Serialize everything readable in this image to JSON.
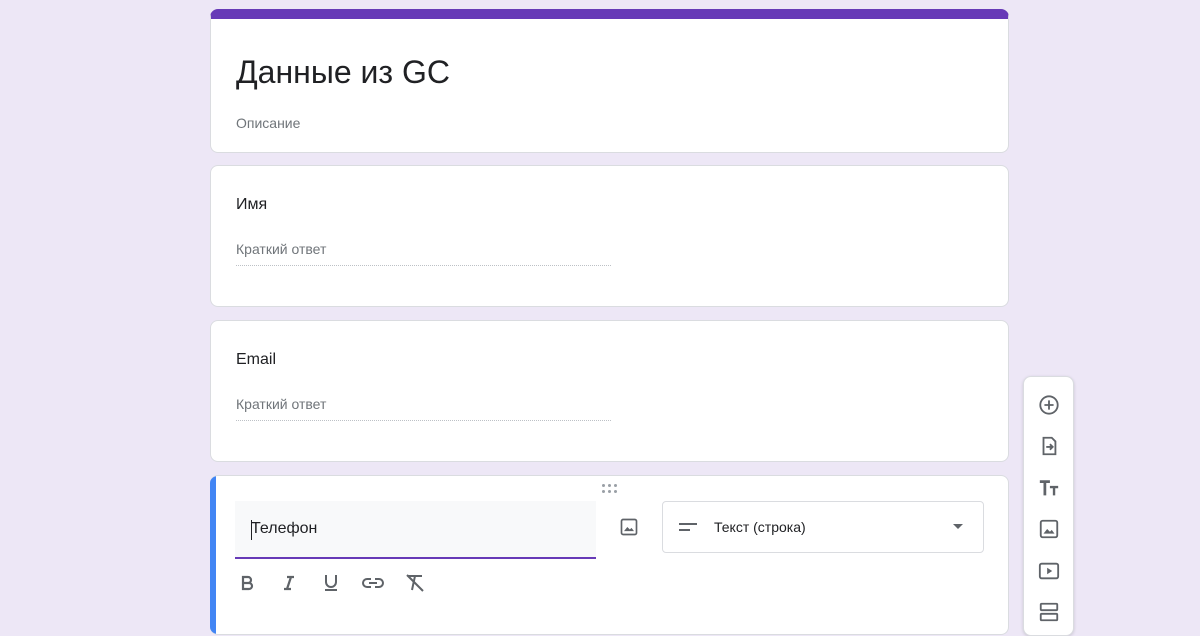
{
  "form": {
    "title": "Данные из GC",
    "description_placeholder": "Описание"
  },
  "questions": [
    {
      "title": "Имя",
      "answer_placeholder": "Краткий ответ"
    },
    {
      "title": "Email",
      "answer_placeholder": "Краткий ответ"
    }
  ],
  "active_question": {
    "title_value": "Телефон",
    "type_label": "Текст (строка)"
  },
  "colors": {
    "theme": "#673ab7",
    "background": "#ede7f6",
    "active_indicator": "#4285f4"
  },
  "formatting_tools": [
    "bold-icon",
    "italic-icon",
    "underline-icon",
    "link-icon",
    "clear-format-icon"
  ],
  "side_toolbar": [
    "add-question-icon",
    "import-questions-icon",
    "add-title-icon",
    "add-image-icon",
    "add-video-icon",
    "add-section-icon"
  ]
}
